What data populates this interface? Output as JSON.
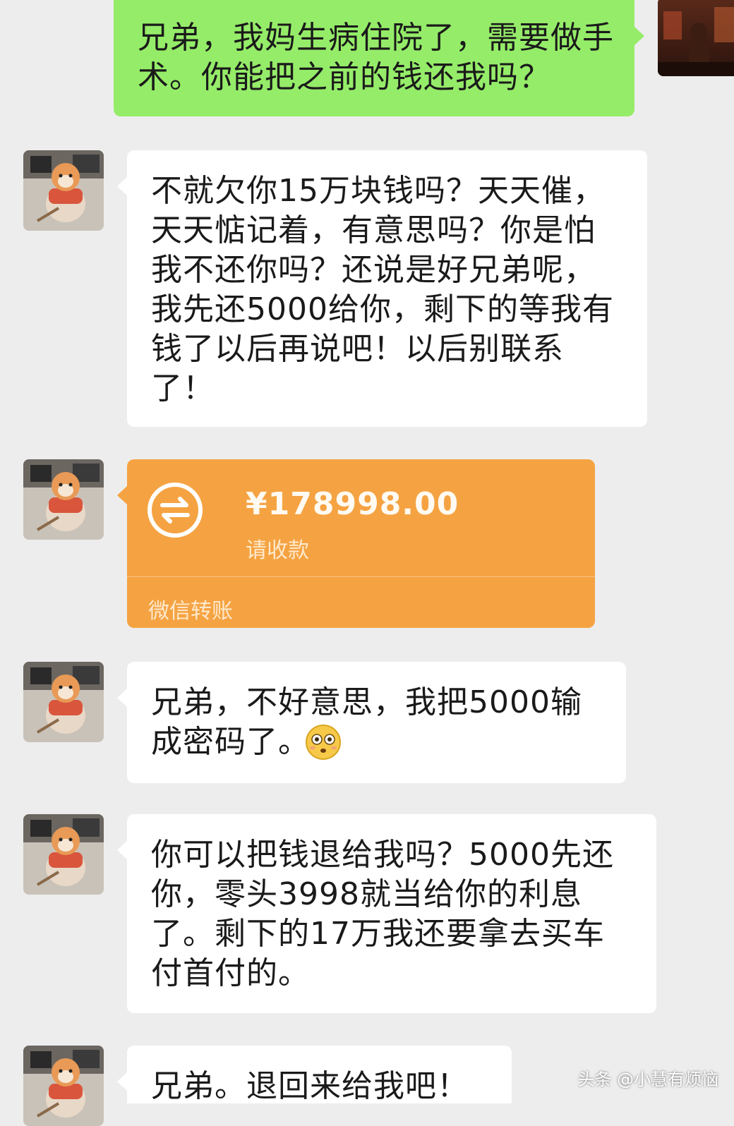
{
  "messages": [
    {
      "side": "right",
      "text": "兄弟，我妈生病住院了，需要做手术。你能把之前的钱还我吗？"
    },
    {
      "side": "left",
      "text": "不就欠你15万块钱吗？天天催，天天惦记着，有意思吗？你是怕我不还你吗？还说是好兄弟呢，我先还5000给你，剩下的等我有钱了以后再说吧！以后别联系了！"
    },
    {
      "side": "left",
      "type": "transfer"
    },
    {
      "side": "left",
      "text": "兄弟，不好意思，我把5000输成密码了。",
      "emoji": "flushed-face-icon"
    },
    {
      "side": "left",
      "text": "你可以把钱退给我吗？5000先还你，零头3998就当给你的利息了。剩下的17万我还要拿去买车付首付的。"
    },
    {
      "side": "left",
      "text": "兄弟。退回来给我吧！"
    }
  ],
  "transfer": {
    "amount": "¥178998.00",
    "status": "请收款",
    "label": "微信转账",
    "icon": "transfer-arrows-icon"
  },
  "watermark": "头条 @小慧有烦恼",
  "colors": {
    "background": "#ededed",
    "green_bubble": "#95ec69",
    "white_bubble": "#ffffff",
    "transfer_orange": "#f5a342"
  }
}
